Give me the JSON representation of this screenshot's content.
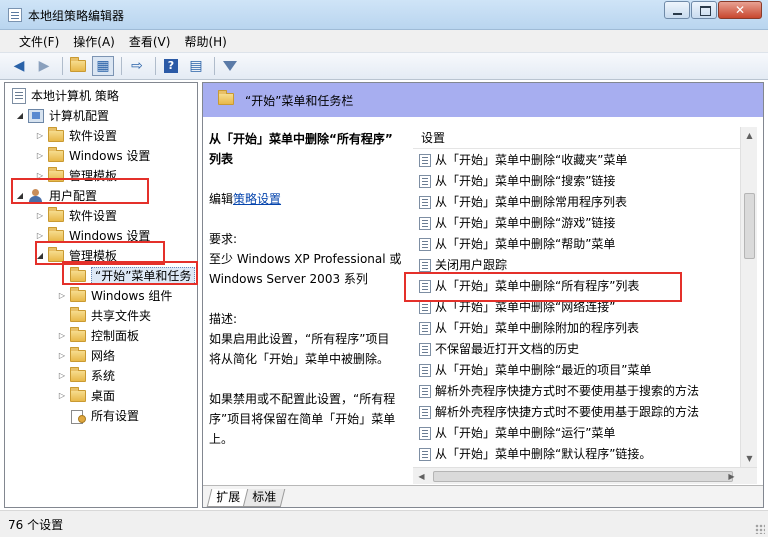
{
  "window": {
    "title": "本地组策略编辑器"
  },
  "menu": [
    "文件(F)",
    "操作(A)",
    "查看(V)",
    "帮助(H)"
  ],
  "toolbar": [
    "back-icon",
    "forward-icon",
    "up-folder-icon",
    "show-hide-tree-icon",
    "export-list-icon",
    "help-icon",
    "properties-icon",
    "filter-icon"
  ],
  "tree": {
    "items": [
      {
        "label": "本地计算机 策略",
        "indent": 0,
        "icon": "policy-icon",
        "expander": ""
      },
      {
        "label": "计算机配置",
        "indent": 1,
        "icon": "computer-icon",
        "expander": "open"
      },
      {
        "label": "软件设置",
        "indent": 2,
        "icon": "folder-icon",
        "expander": "closed"
      },
      {
        "label": "Windows 设置",
        "indent": 2,
        "icon": "folder-icon",
        "expander": "closed"
      },
      {
        "label": "管理模板",
        "indent": 2,
        "icon": "folder-icon",
        "expander": "closed"
      },
      {
        "label": "用户配置",
        "indent": 1,
        "icon": "user-icon",
        "expander": "open"
      },
      {
        "label": "软件设置",
        "indent": 2,
        "icon": "folder-icon",
        "expander": "closed"
      },
      {
        "label": "Windows 设置",
        "indent": 2,
        "icon": "folder-icon",
        "expander": "closed"
      },
      {
        "label": "管理模板",
        "indent": 2,
        "icon": "folder-icon",
        "expander": "open"
      },
      {
        "label": "“开始”菜单和任务",
        "indent": 3,
        "icon": "folder-icon",
        "expander": "",
        "selected": true
      },
      {
        "label": "Windows 组件",
        "indent": 3,
        "icon": "folder-icon",
        "expander": "closed"
      },
      {
        "label": "共享文件夹",
        "indent": 3,
        "icon": "folder-icon",
        "expander": ""
      },
      {
        "label": "控制面板",
        "indent": 3,
        "icon": "folder-icon",
        "expander": "closed"
      },
      {
        "label": "网络",
        "indent": 3,
        "icon": "folder-icon",
        "expander": "closed"
      },
      {
        "label": "系统",
        "indent": 3,
        "icon": "folder-icon",
        "expander": "closed"
      },
      {
        "label": "桌面",
        "indent": 3,
        "icon": "folder-icon",
        "expander": "closed"
      },
      {
        "label": "所有设置",
        "indent": 3,
        "icon": "settings-icon",
        "expander": ""
      }
    ]
  },
  "content": {
    "header_title": "“开始”菜单和任务栏",
    "desc": {
      "title_line1": "从「开始」菜单中删除“所有程序”",
      "title_line2": "列表",
      "edit_prefix": "编辑",
      "edit_link": "策略设置",
      "req_label": "要求:",
      "req_line1": "至少 Windows XP Professional 或",
      "req_line2": "Windows Server 2003 系列",
      "desc_label": "描述:",
      "desc_line1": "如果启用此设置，“所有程序”项目",
      "desc_line2": "将从简化「开始」菜单中被删除。",
      "desc_line3": "如果禁用或不配置此设置，“所有程",
      "desc_line4": "序”项目将保留在简单「开始」菜单",
      "desc_line5": "上。"
    },
    "list_header": "设置",
    "settings": [
      "从「开始」菜单中删除“收藏夹”菜单",
      "从「开始」菜单中删除“搜索”链接",
      "从「开始」菜单中删除常用程序列表",
      "从「开始」菜单中删除“游戏”链接",
      "从「开始」菜单中删除“帮助”菜单",
      "关闭用户跟踪",
      "从「开始」菜单中删除“所有程序”列表",
      "从「开始」菜单中删除“网络连接”",
      "从「开始」菜单中删除附加的程序列表",
      "不保留最近打开文档的历史",
      "从「开始」菜单中删除“最近的项目”菜单",
      "解析外壳程序快捷方式时不要使用基于搜索的方法",
      "解析外壳程序快捷方式时不要使用基于跟踪的方法",
      "从「开始」菜单中删除“运行”菜单",
      "从「开始」菜单中删除“默认程序”链接。"
    ],
    "tabs": [
      "扩展",
      "标准"
    ]
  },
  "status": {
    "text": "76 个设置"
  },
  "colors": {
    "highlight": "#e4302a",
    "header_bg": "#a7aef0"
  }
}
